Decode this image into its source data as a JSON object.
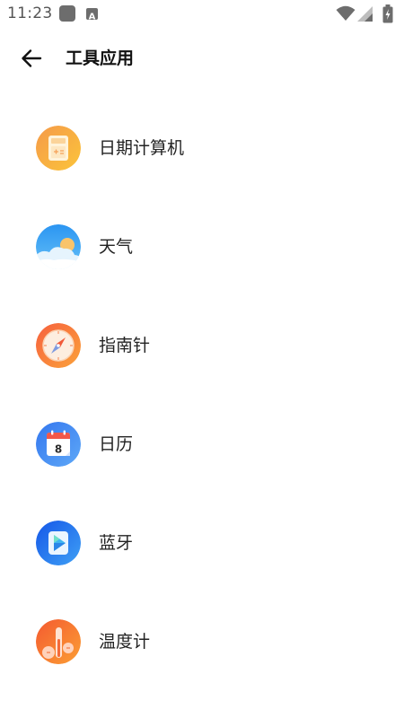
{
  "status_bar": {
    "time": "11:23",
    "icons": [
      "notification-square-icon",
      "accessibility-a-icon",
      "wifi-icon",
      "cell-signal-icon",
      "battery-charging-icon"
    ]
  },
  "header": {
    "back_icon": "arrow-left-icon",
    "title": "工具应用"
  },
  "apps": [
    {
      "label": "日期计算机",
      "icon": "date-calculator-icon",
      "color": "#f5a623"
    },
    {
      "label": "天气",
      "icon": "weather-icon",
      "color": "#3aa4f3"
    },
    {
      "label": "指南针",
      "icon": "compass-icon",
      "color": "#f7743c"
    },
    {
      "label": "日历",
      "icon": "calendar-icon",
      "color": "#3f86f5",
      "icon_text": "8"
    },
    {
      "label": "蓝牙",
      "icon": "bluetooth-icon",
      "color": "#1d6ff2"
    },
    {
      "label": "温度计",
      "icon": "thermometer-icon",
      "color": "#f7782f"
    }
  ]
}
